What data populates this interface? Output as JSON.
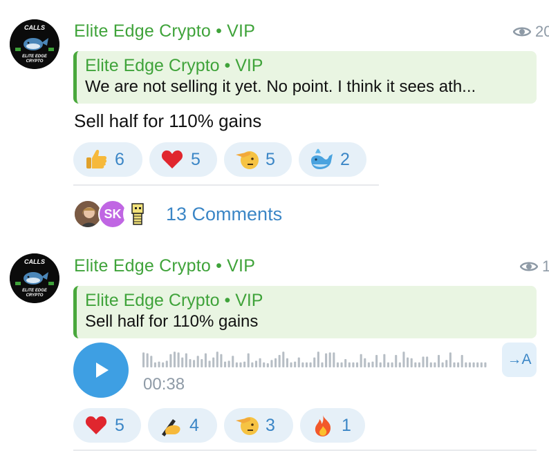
{
  "post1": {
    "avatar_icon": "calls-whale-logo",
    "avatar_text_top": "CALLS",
    "avatar_text_bottom": "ELITE EDGE CRYPTO",
    "channel_name": "Elite Edge Crypto • VIP",
    "views": "20",
    "reply": {
      "author": "Elite Edge Crypto • VIP",
      "text": "We are not selling it yet. No point. I think it sees ath..."
    },
    "message": "Sell half for 110% gains",
    "reactions": [
      {
        "icon": "thumbs-up-icon",
        "count": "6"
      },
      {
        "icon": "red-heart-icon",
        "count": "5"
      },
      {
        "icon": "salute-face-icon",
        "count": "5"
      },
      {
        "icon": "whale-icon",
        "count": "2"
      }
    ],
    "commenter_avatars": [
      {
        "icon": "user-photo-avatar"
      },
      {
        "icon": "initials-avatar",
        "initials": "SK"
      },
      {
        "icon": "pixel-art-avatar"
      }
    ],
    "comments_label": "13 Comments"
  },
  "post2": {
    "avatar_icon": "calls-whale-logo",
    "avatar_text_top": "CALLS",
    "avatar_text_bottom": "ELITE EDGE CRYPTO",
    "channel_name": "Elite Edge Crypto • VIP",
    "views": "1",
    "reply": {
      "author": "Elite Edge Crypto • VIP",
      "text": "Sell half for 110% gains"
    },
    "voice": {
      "duration": "00:38",
      "transcribe_label": "→A",
      "waveform_levels": [
        0.9,
        0.85,
        0.7,
        0.3,
        0.35,
        0.3,
        0.4,
        0.8,
        0.95,
        0.9,
        0.6,
        0.85,
        0.5,
        0.45,
        0.7,
        0.5,
        0.85,
        0.4,
        0.6,
        0.95,
        0.8,
        0.35,
        0.4,
        0.7,
        0.3,
        0.3,
        0.35,
        0.85,
        0.3,
        0.4,
        0.55,
        0.3,
        0.25,
        0.45,
        0.55,
        0.75,
        0.95,
        0.55,
        0.3,
        0.35,
        0.6,
        0.3,
        0.3,
        0.3,
        0.6,
        0.95,
        0.3,
        0.85,
        0.9,
        0.9,
        0.3,
        0.3,
        0.5,
        0.3,
        0.3,
        0.3,
        0.8,
        0.55,
        0.3,
        0.35,
        0.75,
        0.3,
        0.8,
        0.3,
        0.3,
        0.75,
        0.3,
        0.95,
        0.6,
        0.55,
        0.3,
        0.3,
        0.65,
        0.65,
        0.3,
        0.3,
        0.75,
        0.3,
        0.45,
        0.9,
        0.3,
        0.3,
        0.75,
        0.3,
        0.3,
        0.3,
        0.3,
        0.3,
        0.3
      ]
    },
    "reactions": [
      {
        "icon": "red-heart-icon",
        "count": "5"
      },
      {
        "icon": "writing-hand-icon",
        "count": "4"
      },
      {
        "icon": "salute-face-icon",
        "count": "3"
      },
      {
        "icon": "fire-icon",
        "count": "1"
      }
    ]
  },
  "colors": {
    "channel_green": "#3fa33a",
    "quote_bg": "#e9f5e2",
    "reaction_bg": "#e6f0f8",
    "link_blue": "#3b86c6",
    "play_blue": "#3e9fe3"
  }
}
